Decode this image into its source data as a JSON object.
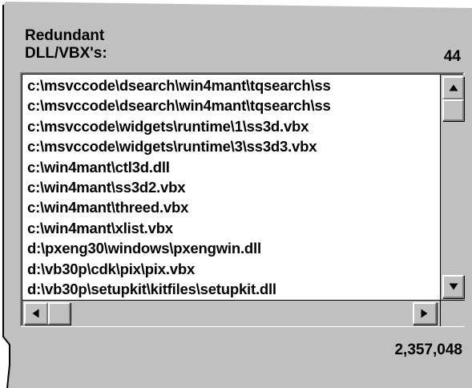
{
  "panel": {
    "label_line1": "Redundant",
    "label_line2": "DLL/VBX's:",
    "count": "44",
    "total": "2,357,048"
  },
  "list": {
    "items": [
      "c:\\msvccode\\dsearch\\win4mant\\tqsearch\\ss",
      "c:\\msvccode\\dsearch\\win4mant\\tqsearch\\ss",
      "c:\\msvccode\\widgets\\runtime\\1\\ss3d.vbx",
      "c:\\msvccode\\widgets\\runtime\\3\\ss3d3.vbx",
      "c:\\win4mant\\ctl3d.dll",
      "c:\\win4mant\\ss3d2.vbx",
      "c:\\win4mant\\threed.vbx",
      "c:\\win4mant\\xlist.vbx",
      "d:\\pxeng30\\windows\\pxengwin.dll",
      "d:\\vb30p\\cdk\\pix\\pix.vbx",
      "d:\\vb30p\\setupkit\\kitfiles\\setupkit.dll"
    ]
  },
  "scrollbars": {
    "icons": [
      "up-arrow-icon",
      "down-arrow-icon",
      "left-arrow-icon",
      "right-arrow-icon"
    ]
  },
  "colors": {
    "panel_face": "#c0c0c0",
    "list_background": "#ffffff",
    "text": "#000000"
  }
}
